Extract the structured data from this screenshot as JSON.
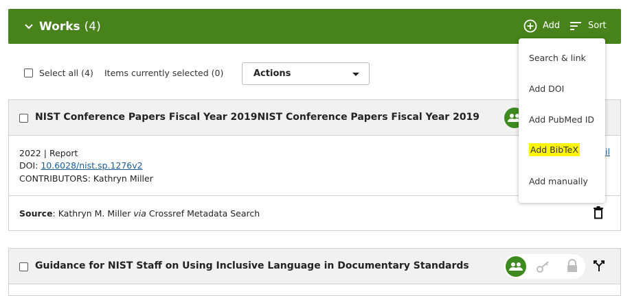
{
  "header": {
    "title": "Works",
    "count": "(4)",
    "add_label": "Add",
    "sort_label": "Sort",
    "bg_color": "#47821a"
  },
  "selection": {
    "select_all_label": "Select all (4)",
    "items_selected_label": "Items currently selected (0)",
    "actions_label": "Actions"
  },
  "works": [
    {
      "title": "NIST Conference Papers Fiscal Year 2019NIST Conference Papers Fiscal Year 2019",
      "year_type": "2022 | Report",
      "doi_label": "DOI: ",
      "doi_value": "10.6028/nist.sp.1276v2",
      "contributors": "CONTRIBUTORS: Kathryn Miller",
      "source_label": "Source",
      "source_value": ": Kathryn M. Miller ",
      "source_via": "via",
      "source_tool": " Crossref Metadata Search",
      "cut_link_text": "il"
    },
    {
      "title": "Guidance for NIST Staff on Using Inclusive Language in Documentary Standards"
    }
  ],
  "add_menu": {
    "items": [
      "Search & link",
      "Add DOI",
      "Add PubMed ID",
      "Add BibTeX",
      "Add manually"
    ],
    "highlighted_index": 3,
    "highlight_color": "#fff40a"
  },
  "icons": {
    "header_chevron": "chevron-down-icon",
    "add": "plus-circle-icon",
    "sort": "sort-lines-icon",
    "delete": "trash-icon",
    "visibility_everyone": "people-icon",
    "visibility_trusted": "key-icon",
    "visibility_private": "lock-icon",
    "combine": "merge-icon"
  },
  "accent_green": "#3d8a1f"
}
